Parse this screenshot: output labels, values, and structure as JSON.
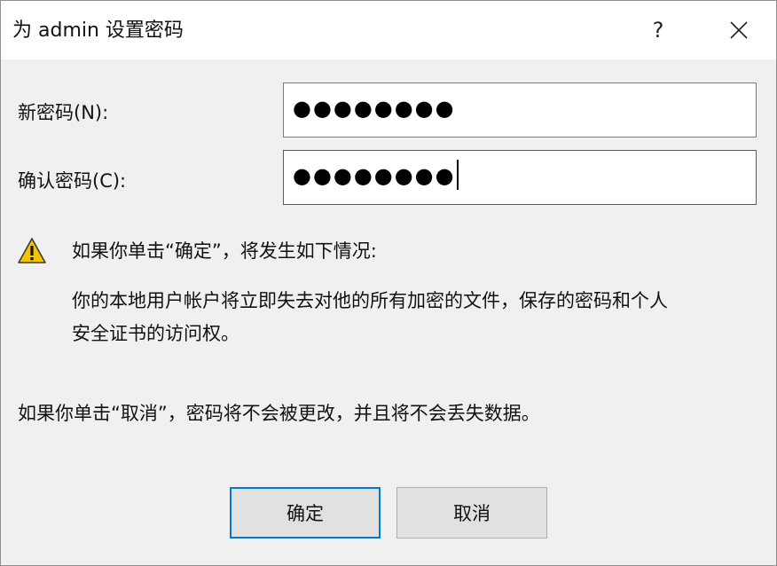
{
  "window": {
    "title": "为 admin 设置密码",
    "help_label": "?",
    "close_icon": "close-icon"
  },
  "form": {
    "new_password_label": "新密码(N):",
    "new_password_value": "●●●●●●●●",
    "confirm_password_label": "确认密码(C):",
    "confirm_password_value": "●●●●●●●●"
  },
  "warning": {
    "icon": "warning-icon",
    "icon_color": "#f5c400",
    "heading": "如果你单击“确定”，将发生如下情况:",
    "detail_line1": "你的本地用户帐户将立即失去对他的所有加密的文件，保存的密码和个人",
    "detail_line2": "安全证书的访问权。",
    "cancel_note": "如果你单击“取消”，密码将不会被更改，并且将不会丢失数据。"
  },
  "buttons": {
    "ok_label": "确定",
    "cancel_label": "取消",
    "default_border_color": "#0078d7"
  }
}
